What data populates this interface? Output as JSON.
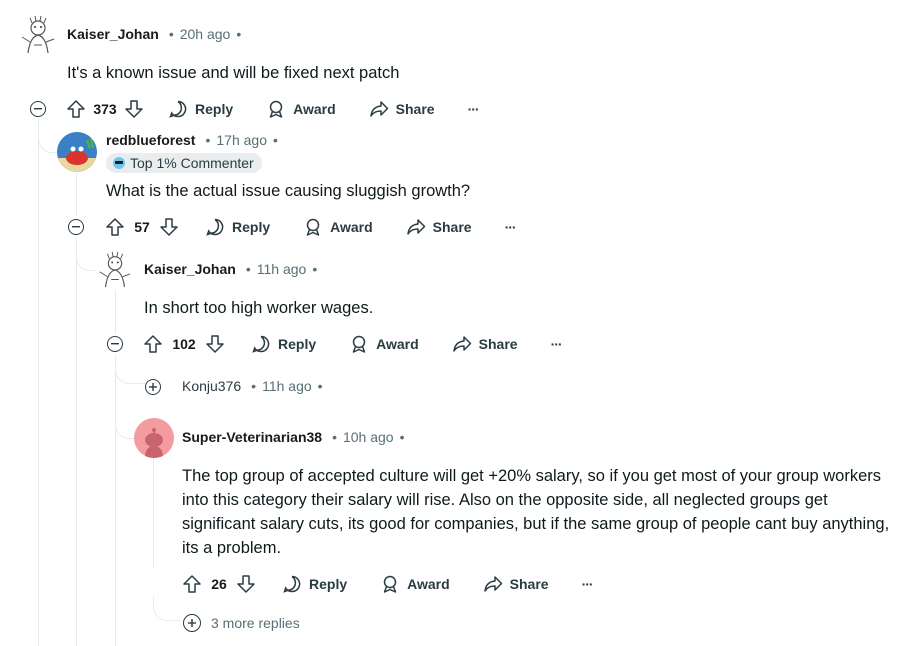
{
  "comments": [
    {
      "username": "Kaiser_Johan",
      "time": "20h ago",
      "body": "It's a known issue and will be fixed next patch",
      "score": "373"
    },
    {
      "username": "redblueforest",
      "time": "17h ago",
      "flair": "Top 1% Commenter",
      "body": "What is the actual issue causing sluggish growth?",
      "score": "57"
    },
    {
      "username": "Kaiser_Johan",
      "time": "11h ago",
      "body": "In short too high worker wages.",
      "score": "102"
    },
    {
      "username": "Konju376",
      "time": "11h ago",
      "collapsed": true
    },
    {
      "username": "Super-Veterinarian38",
      "time": "10h ago",
      "body_lines": [
        "The top group of accepted culture will get +20% salary, so if you get most of your group workers",
        "into this category their salary will rise. Also on the opposite side, all neglected groups get",
        "significant salary cuts, its good for companies, but if the same group of people cant buy anything,",
        "its a problem."
      ],
      "score": "26"
    }
  ],
  "actions": {
    "reply": "Reply",
    "award": "Award",
    "share": "Share",
    "more": "···"
  },
  "more_replies": "3 more replies",
  "meta_separator": "•",
  "colors": {
    "thread_line": "#e5ebee",
    "meta_text": "#576f76",
    "avatar_pink": "#f49ba0"
  },
  "icons": [
    "upvote-icon",
    "downvote-icon",
    "reply-icon",
    "award-icon",
    "share-icon",
    "more-icon",
    "collapse-icon",
    "expand-icon"
  ]
}
